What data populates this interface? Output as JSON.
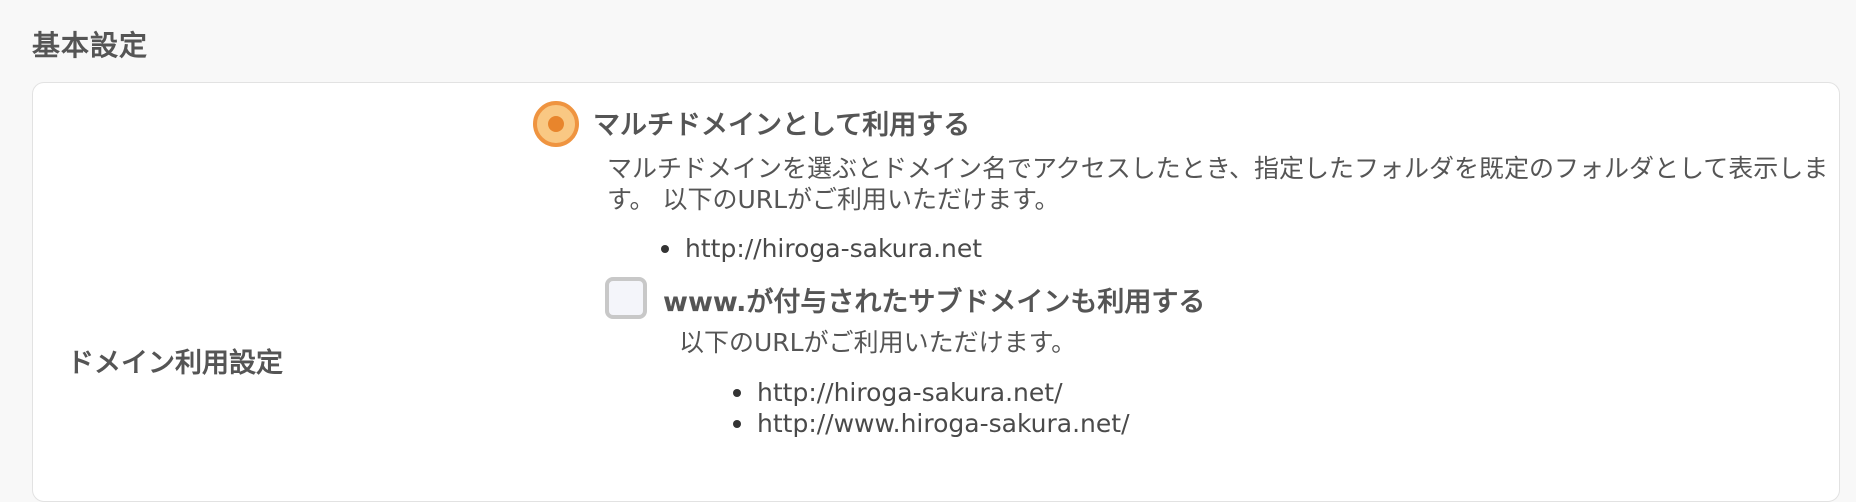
{
  "section": {
    "title": "基本設定"
  },
  "domain_setting": {
    "label": "ドメイン利用設定",
    "multidomain_option": {
      "label": "マルチドメインとして利用する",
      "selected": true,
      "description": "マルチドメインを選ぶとドメイン名でアクセスしたとき、指定したフォルダを既定のフォルダとして表示します。 以下のURLがご利用いただけます。",
      "urls": [
        "http://hiroga-sakura.net"
      ]
    },
    "www_option": {
      "label": "www.が付与されたサブドメインも利用する",
      "checked": false,
      "description": "以下のURLがご利用いただけます。",
      "urls": [
        "http://hiroga-sakura.net/",
        "http://www.hiroga-sakura.net/"
      ]
    }
  },
  "colors": {
    "radio_accent": "#ef9440",
    "radio_fill": "#f9c883",
    "checkbox_border": "#c8c8c8"
  }
}
